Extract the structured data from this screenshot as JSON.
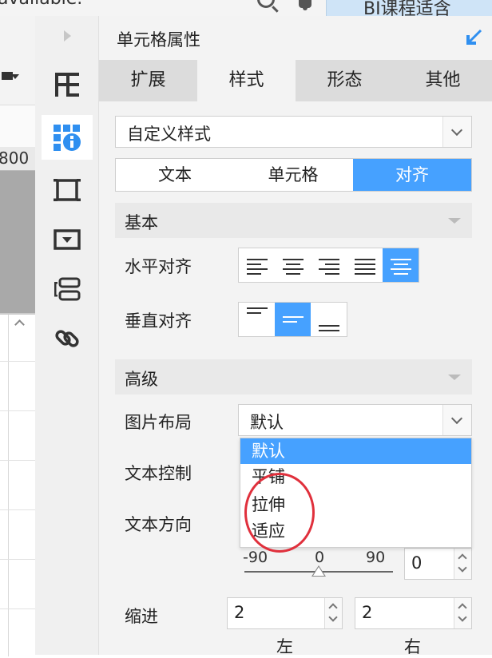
{
  "topbar": {
    "title": "available.",
    "tab_label": "BI课程适含"
  },
  "left_pane": {
    "ruler_value": "800"
  },
  "sidebar": {
    "items": [
      {
        "icon": "layout-grid-icon",
        "active": false
      },
      {
        "icon": "cell-properties-icon",
        "active": true
      },
      {
        "icon": "frame-icon",
        "active": false
      },
      {
        "icon": "widget-icon",
        "active": false
      },
      {
        "icon": "template-icon",
        "active": false
      },
      {
        "icon": "link-icon",
        "active": false
      }
    ]
  },
  "panel": {
    "title": "单元格属性",
    "tabs": [
      "扩展",
      "样式",
      "形态",
      "其他"
    ],
    "active_tab": "样式",
    "style_select": {
      "value": "自定义样式"
    },
    "subtabs": [
      "文本",
      "单元格",
      "对齐"
    ],
    "active_subtab": "对齐",
    "basic_section": "基本",
    "horizontal_align_label": "水平对齐",
    "vertical_align_label": "垂直对齐",
    "advanced_section": "高级",
    "image_layout_label": "图片布局",
    "image_layout_value": "默认",
    "text_control_label": "文本控制",
    "text_direction_label": "文本方向",
    "dropdown_options": [
      "默认",
      "平铺",
      "拉伸",
      "适应"
    ],
    "dropdown_selected": "默认",
    "rotation": {
      "min_label": "-90",
      "mid_label": "0",
      "max_label": "90",
      "value": "0"
    },
    "indent_label": "缩进",
    "indent_left_value": "2",
    "indent_right_value": "2",
    "indent_left_caption": "左",
    "indent_right_caption": "右"
  },
  "colors": {
    "accent": "#46a1ff",
    "annotation": "#e0303c"
  }
}
